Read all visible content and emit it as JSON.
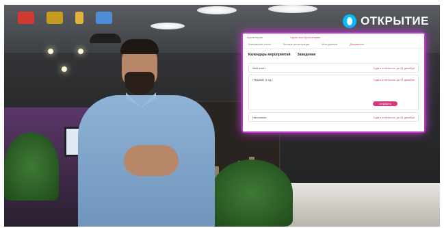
{
  "brand": {
    "name": "ОТКРЫТИЕ",
    "icon": "otkritie-logo-icon",
    "color": "#00bfff"
  },
  "top_logos": [
    "partner-logo-red-icon",
    "crown-logo-icon",
    "award-badge-icon",
    "blue-flag-logo-icon"
  ],
  "screen": {
    "header_left": "Бухгалтерия",
    "header_right": "Сдать всю бухгалтерию",
    "nav": [
      "Банковские счета",
      "Личные регистрации",
      "Мои данные",
      "Документы"
    ],
    "tabs": [
      "Календарь мероприятий",
      "Заведения"
    ],
    "rows": [
      {
        "label": "Мой отчёт",
        "status": "Сдать отчётность до 31 декабря"
      },
      {
        "label": "ПФДИВВ (1 ед.)",
        "status": "Сдать отчётность до 31 декабря"
      },
      {
        "label": "Налоговые",
        "status": "Сдать отчётность до 31 декабря"
      }
    ],
    "card_button": "Отправить",
    "accent": "#c03bcf"
  }
}
